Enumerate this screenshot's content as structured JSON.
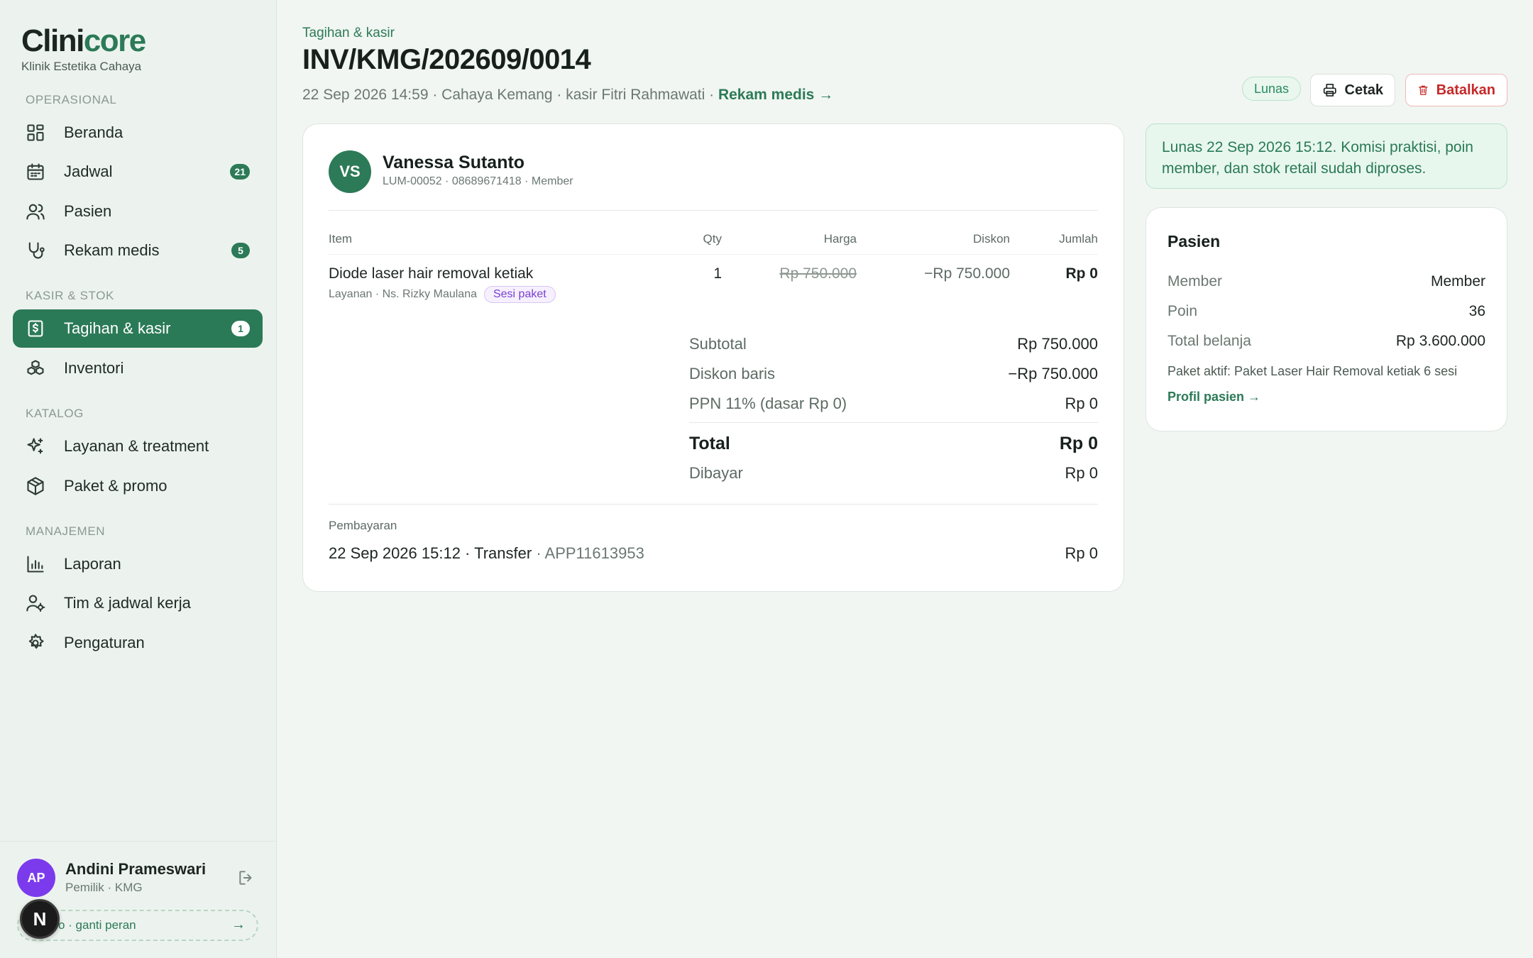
{
  "brand": {
    "name_part1": "Clini",
    "name_part2": "core",
    "clinic": "Klinik Estetika Cahaya"
  },
  "sidebar": {
    "sections": {
      "operasional": "OPERASIONAL",
      "kasir_stok": "KASIR & STOK",
      "katalog": "KATALOG",
      "manajemen": "MANAJEMEN"
    },
    "items": {
      "beranda": {
        "label": "Beranda"
      },
      "jadwal": {
        "label": "Jadwal",
        "badge": "21"
      },
      "pasien": {
        "label": "Pasien"
      },
      "rekam_medis": {
        "label": "Rekam medis",
        "badge": "5"
      },
      "tagihan": {
        "label": "Tagihan & kasir",
        "badge": "1"
      },
      "inventori": {
        "label": "Inventori"
      },
      "layanan": {
        "label": "Layanan & treatment"
      },
      "paket": {
        "label": "Paket & promo"
      },
      "laporan": {
        "label": "Laporan"
      },
      "tim": {
        "label": "Tim & jadwal kerja"
      },
      "pengaturan": {
        "label": "Pengaturan"
      }
    },
    "user": {
      "initials": "AP",
      "name": "Andini Prameswari",
      "role": "Pemilik · KMG",
      "switch_label": "o · ganti peran",
      "switch_arrow": "→"
    },
    "bubble": "N"
  },
  "header": {
    "breadcrumb": "Tagihan & kasir",
    "title": "INV/KMG/202609/0014",
    "meta": "22 Sep 2026 14:59 · Cahaya Kemang · kasir Fitri Rahmawati · ",
    "meta_link": "Rekam medis →",
    "status": "Lunas",
    "print_label": "Cetak",
    "cancel_label": "Batalkan"
  },
  "invoice": {
    "patient": {
      "initials": "VS",
      "name": "Vanessa Sutanto",
      "meta": "LUM-00052 · 08689671418 · Member"
    },
    "columns": {
      "item": "Item",
      "qty": "Qty",
      "price": "Harga",
      "discount": "Diskon",
      "amount": "Jumlah"
    },
    "rows": [
      {
        "name": "Diode laser hair removal ketiak",
        "sub": "Layanan  · Ns. Rizky Maulana",
        "chip": "Sesi paket",
        "qty": "1",
        "price": "Rp 750.000",
        "discount": "−Rp 750.000",
        "amount": "Rp 0"
      }
    ],
    "summary": {
      "subtotal_label": "Subtotal",
      "subtotal": "Rp 750.000",
      "line_discount_label": "Diskon baris",
      "line_discount": "−Rp 750.000",
      "tax_label": "PPN 11% (dasar Rp 0)",
      "tax": "Rp 0",
      "total_label": "Total",
      "total": "Rp 0",
      "paid_label": "Dibayar",
      "paid": "Rp 0"
    },
    "payment": {
      "label": "Pembayaran",
      "line": "22 Sep 2026 15:12 · Transfer",
      "ref": " · APP11613953",
      "amount": "Rp 0"
    }
  },
  "notice": "Lunas 22 Sep 2026 15:12. Komisi praktisi, poin member, dan stok retail sudah diproses.",
  "patient_card": {
    "title": "Pasien",
    "member_label": "Member",
    "member": "Member",
    "points_label": "Poin",
    "points": "36",
    "spend_label": "Total belanja",
    "spend": "Rp 3.600.000",
    "package": "Paket aktif: Paket Laser Hair Removal ketiak 6 sesi",
    "link": "Profil pasien →"
  },
  "colors": {
    "accent": "#2c7a57",
    "danger": "#c62828",
    "chip": "#7b3fd0"
  }
}
